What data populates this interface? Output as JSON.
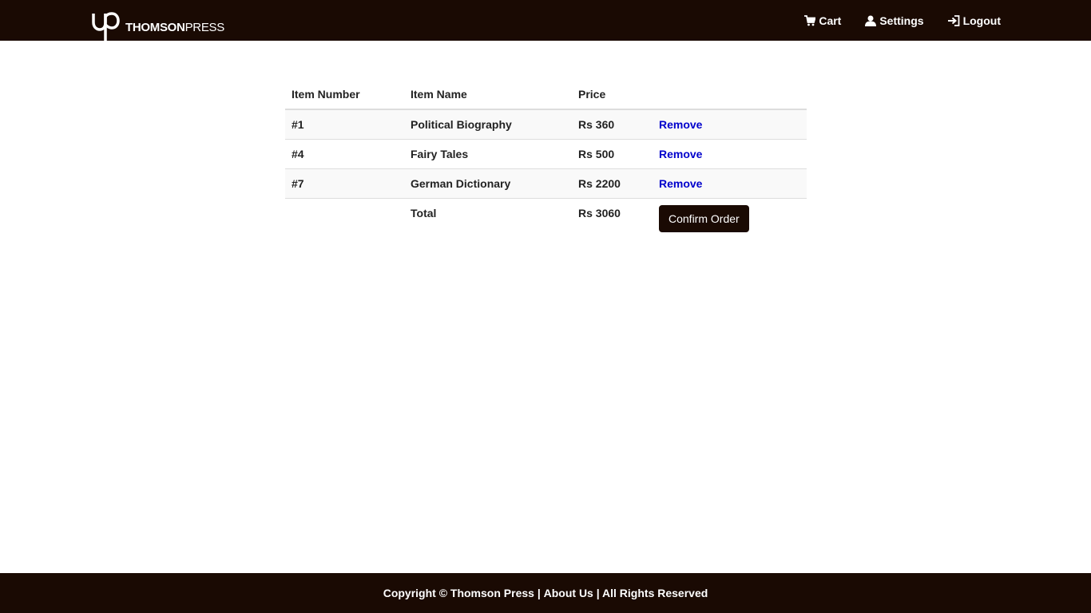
{
  "brand": {
    "logo_text_strong": "THOMSON",
    "logo_text_light": "PRESS"
  },
  "nav": {
    "cart": "Cart",
    "settings": "Settings",
    "logout": "Logout"
  },
  "table": {
    "headers": [
      "Item Number",
      "Item Name",
      "Price"
    ],
    "rows": [
      {
        "number": "#1",
        "name": "Political Biography",
        "price": "Rs 360",
        "action": "Remove"
      },
      {
        "number": "#4",
        "name": "Fairy Tales",
        "price": "Rs 500",
        "action": "Remove"
      },
      {
        "number": "#7",
        "name": "German Dictionary",
        "price": "Rs 2200",
        "action": "Remove"
      }
    ],
    "total_label": "Total",
    "total_value": "Rs 3060",
    "confirm_label": "Confirm Order"
  },
  "footer": {
    "copyright": "Copyright © Thomson Press | ",
    "about": "About Us",
    "rights": " | All Rights Reserved"
  },
  "colors": {
    "bar_bg": "#1a0a03",
    "link": "#0000cc",
    "stripe": "#f9f9f9"
  }
}
